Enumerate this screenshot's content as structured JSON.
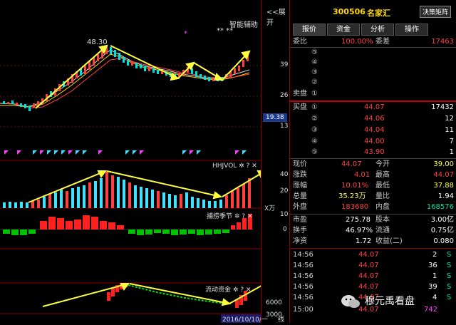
{
  "chart": {
    "expand_label": "<<展开",
    "assist_label": "智能辅助",
    "stars": "** **",
    "peak_label": "48.30",
    "price_axis": [
      "39",
      "26",
      "13"
    ],
    "current_price_tag": "19.38",
    "indicators": [
      {
        "name": "HHJVOL",
        "axis": [
          "40",
          "20"
        ],
        "unit": "X万"
      },
      {
        "name": "捕捞季节",
        "axis": [
          "10",
          "0"
        ]
      },
      {
        "name": "流动资金",
        "axis": [
          "6000",
          "3000"
        ],
        "unit": "X万"
      }
    ],
    "date_label": "2016/10/10/一",
    "line_label": "线",
    "icon_buttons": [
      "gear-icon",
      "help-icon",
      "up-arrow-icon"
    ]
  },
  "quote": {
    "code": "300506",
    "name": "名家汇",
    "decision_button": "决策矩阵",
    "tabs": [
      "报价",
      "资金",
      "分析",
      "操作"
    ],
    "weibi_label": "委比",
    "weibi_value": "100.00%",
    "weicha_label": "委差",
    "weicha_value": "17463",
    "sell_levels": [
      "⑤",
      "④",
      "③",
      "②",
      "①"
    ],
    "sell_label": "卖盘",
    "buy_label": "买盘",
    "buy_levels": [
      {
        "idx": "①",
        "price": "44.07",
        "vol": "17432"
      },
      {
        "idx": "②",
        "price": "44.06",
        "vol": "12"
      },
      {
        "idx": "③",
        "price": "44.04",
        "vol": "11"
      },
      {
        "idx": "④",
        "price": "44.00",
        "vol": "7"
      },
      {
        "idx": "⑤",
        "price": "43.90",
        "vol": "1"
      }
    ],
    "stats": [
      {
        "l1": "现价",
        "v1": "44.07",
        "c1": "red",
        "l2": "今开",
        "v2": "39.00",
        "c2": "yellow"
      },
      {
        "l1": "涨跌",
        "v1": "4.01",
        "c1": "red",
        "l2": "最高",
        "v2": "44.07",
        "c2": "red"
      },
      {
        "l1": "涨幅",
        "v1": "10.01%",
        "c1": "red",
        "l2": "最低",
        "v2": "37.88",
        "c2": "yellow"
      },
      {
        "l1": "总量",
        "v1": "35.23万",
        "c1": "yellow",
        "l2": "量比",
        "v2": "1.94",
        "c2": "white"
      },
      {
        "l1": "外盘",
        "v1": "183680",
        "c1": "red",
        "l2": "内盘",
        "v2": "168576",
        "c2": "green"
      }
    ],
    "stats2": [
      {
        "l1": "市盈",
        "v1": "275.78",
        "l2": "股本",
        "v2": "3.00亿"
      },
      {
        "l1": "换手",
        "v1": "46.97%",
        "l2": "流通",
        "v2": "0.75亿"
      },
      {
        "l1": "净资",
        "v1": "1.72",
        "l2": "收益(二)",
        "v2": "0.080"
      }
    ],
    "ticks": [
      {
        "time": "14:56",
        "price": "44.07",
        "vol": "2",
        "dir": "S"
      },
      {
        "time": "14:56",
        "price": "44.07",
        "vol": "36",
        "dir": "S"
      },
      {
        "time": "14:56",
        "price": "44.07",
        "vol": "1",
        "dir": "S"
      },
      {
        "time": "14:56",
        "price": "44.07",
        "vol": "39",
        "dir": "S"
      },
      {
        "time": "14:56",
        "price": "44.07",
        "vol": "4",
        "dir": "S"
      },
      {
        "time": "15:00",
        "price": "44.07",
        "vol": "742",
        "dir": ""
      }
    ]
  },
  "watermark": "穆元禹看盘"
}
